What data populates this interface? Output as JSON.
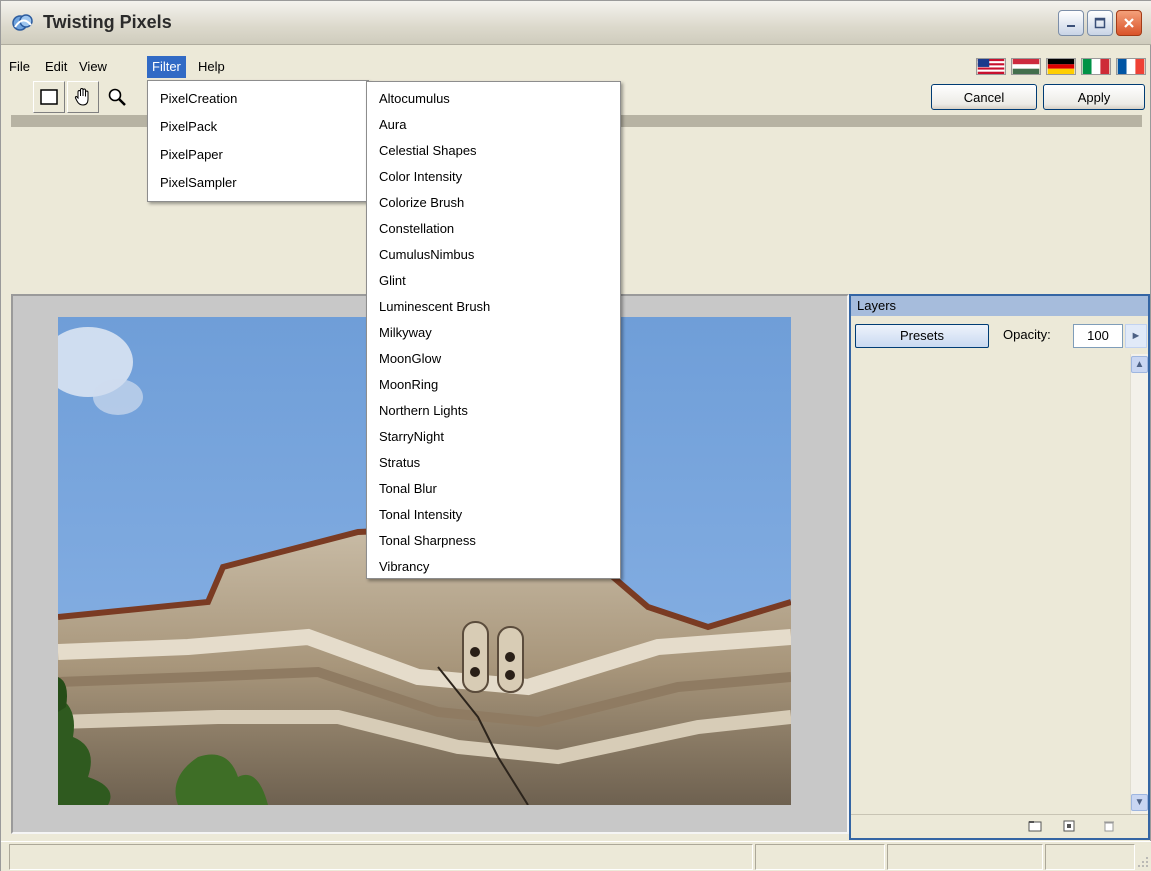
{
  "window": {
    "title": "Twisting Pixels"
  },
  "menu": {
    "items": [
      "File",
      "Edit",
      "View",
      "Filter",
      "Help"
    ],
    "active": "Filter"
  },
  "filter_menu": {
    "items": [
      "PixelCreation",
      "PixelPack",
      "PixelPaper",
      "PixelSampler"
    ]
  },
  "submenu": {
    "items": [
      "Altocumulus",
      "Aura",
      "Celestial Shapes",
      "Color Intensity",
      "Colorize Brush",
      "Constellation",
      "CumulusNimbus",
      "Glint",
      "Luminescent Brush",
      "Milkyway",
      "MoonGlow",
      "MoonRing",
      "Northern Lights",
      "StarryNight",
      "Stratus",
      "Tonal Blur",
      "Tonal Intensity",
      "Tonal Sharpness",
      "Vibrancy"
    ]
  },
  "toolbar": {
    "cancel_label": "Cancel",
    "apply_label": "Apply",
    "tools": [
      "rectangle-select-icon",
      "hand-icon",
      "zoom-icon"
    ]
  },
  "language_flags": [
    "us-flag-icon",
    "hungary-flag-icon",
    "germany-flag-icon",
    "italy-flag-icon",
    "france-flag-icon"
  ],
  "layers": {
    "title": "Layers",
    "presets_label": "Presets",
    "opacity_label": "Opacity:",
    "opacity_value": "100"
  },
  "colors": {
    "menu_highlight": "#316ac5",
    "panel_border": "#3465a4",
    "window_bg": "#ece9d8"
  }
}
